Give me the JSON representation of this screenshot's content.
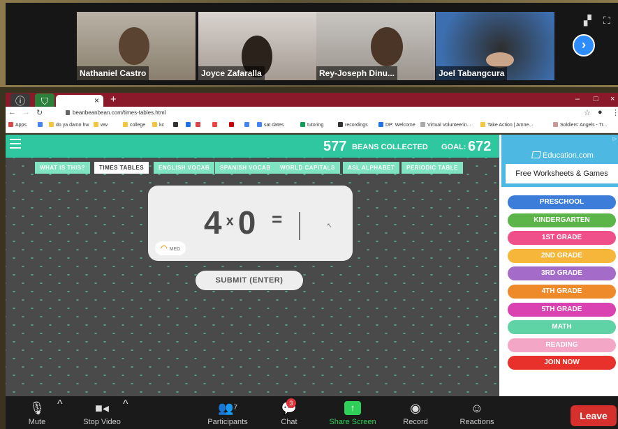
{
  "participants": [
    {
      "name": "Nathaniel Castro"
    },
    {
      "name": "Joyce Zafaralla"
    },
    {
      "name": "Rey-Joseph Dinu..."
    },
    {
      "name": "Joel Tabangcura"
    }
  ],
  "video_icons": {
    "gallery": "▞",
    "fullscreen": "⛶",
    "next": "›"
  },
  "browser": {
    "url": "beanbeanbean.com/times-tables.html",
    "tab_close": "×",
    "new_tab": "+",
    "window_controls": {
      "minimize": "–",
      "maximize": "□",
      "close": "×"
    },
    "bookmarks": [
      {
        "label": "Apps",
        "color": "#d44"
      },
      {
        "label": "",
        "color": "#4285f4"
      },
      {
        "label": "do ya damn hw",
        "color": "#f4c542"
      },
      {
        "label": "ww",
        "color": "#f4c542"
      },
      {
        "label": "college",
        "color": "#f4c542"
      },
      {
        "label": "kc",
        "color": "#f4c542"
      },
      {
        "label": "",
        "color": "#333"
      },
      {
        "label": "",
        "color": "#1a73e8"
      },
      {
        "label": "",
        "color": "#d44"
      },
      {
        "label": "",
        "color": "#e44"
      },
      {
        "label": "",
        "color": "#c00"
      },
      {
        "label": "",
        "color": "#4285f4"
      },
      {
        "label": "sat dates",
        "color": "#4285f4"
      },
      {
        "label": "tutoring",
        "color": "#0f9d58"
      },
      {
        "label": "recordings",
        "color": "#333"
      },
      {
        "label": "DP: Welcome",
        "color": "#1a73e8"
      },
      {
        "label": "Virtual Volunteerin...",
        "color": "#aaa"
      },
      {
        "label": "Take Action | Amne...",
        "color": "#f4c542"
      },
      {
        "label": "Soldiers' Angels - Tr...",
        "color": "#c99"
      }
    ]
  },
  "game": {
    "beans_count": "577",
    "beans_label": "BEANS COLLECTED",
    "goal_label": "GOAL:",
    "goal_value": "672",
    "nav": [
      {
        "label": "WHAT IS THIS?",
        "active": false
      },
      {
        "label": "TIMES TABLES",
        "active": true
      },
      {
        "label": "ENGLISH VOCAB",
        "active": false
      },
      {
        "label": "SPANISH VOCAB",
        "active": false
      },
      {
        "label": "WORLD CAPITALS",
        "active": false
      },
      {
        "label": "ASL ALPHABET",
        "active": false
      },
      {
        "label": "PERIODIC TABLE",
        "active": false
      }
    ],
    "question": {
      "a": "4",
      "op": "x",
      "b": "0",
      "eq": "="
    },
    "difficulty": "MED",
    "submit_label": "SUBMIT (ENTER)"
  },
  "ad": {
    "brand": "Education.com",
    "tagline": "Free Worksheets & Games",
    "choice_icon": "▷",
    "grades": [
      {
        "label": "PRESCHOOL",
        "color": "#3b7dd8"
      },
      {
        "label": "KINDERGARTEN",
        "color": "#5bb548"
      },
      {
        "label": "1ST GRADE",
        "color": "#f0508a"
      },
      {
        "label": "2ND GRADE",
        "color": "#f5b63a"
      },
      {
        "label": "3RD GRADE",
        "color": "#a46cc8"
      },
      {
        "label": "4TH GRADE",
        "color": "#ef8a2a"
      },
      {
        "label": "5TH GRADE",
        "color": "#d942b0"
      },
      {
        "label": "MATH",
        "color": "#5fd2a6"
      },
      {
        "label": "READING",
        "color": "#f4a6c6"
      },
      {
        "label": "JOIN NOW",
        "color": "#e8312a"
      }
    ]
  },
  "zoom": {
    "mute": "Mute",
    "stop_video": "Stop Video",
    "participants": "Participants",
    "participants_count": "7",
    "chat": "Chat",
    "chat_badge": "3",
    "share_screen": "Share Screen",
    "record": "Record",
    "reactions": "Reactions",
    "leave": "Leave"
  }
}
